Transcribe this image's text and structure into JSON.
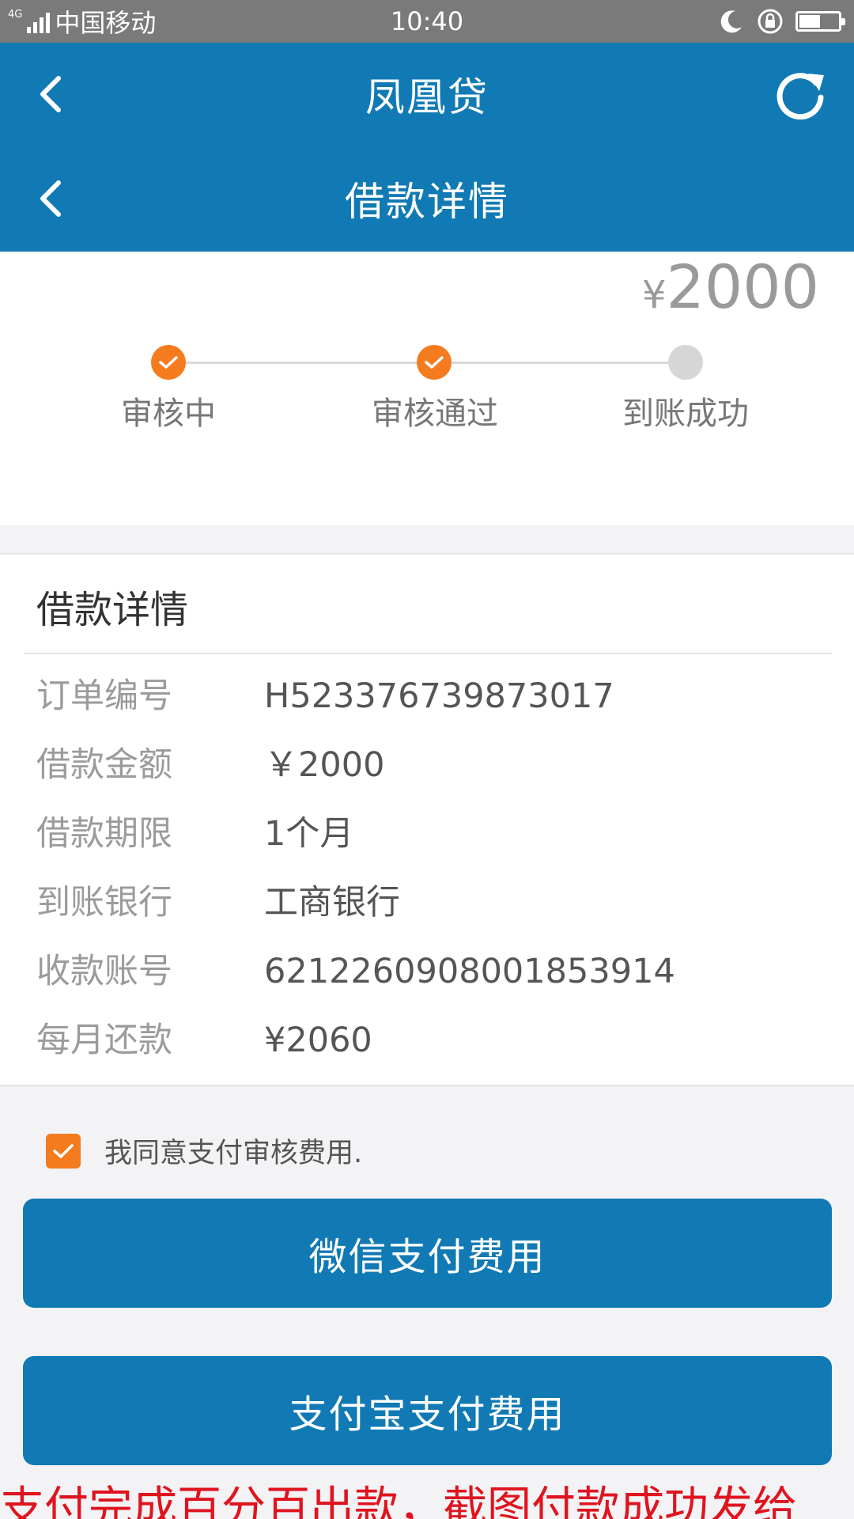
{
  "status_bar": {
    "network_small": "4G",
    "carrier": "中国移动",
    "time": "10:40"
  },
  "header": {
    "app_title": "凤凰贷",
    "page_title": "借款详情"
  },
  "progress": {
    "currency_symbol": "¥",
    "amount": "2000",
    "steps": [
      {
        "label": "审核中",
        "state": "done"
      },
      {
        "label": "审核通过",
        "state": "done"
      },
      {
        "label": "到账成功",
        "state": "pending"
      }
    ]
  },
  "details": {
    "title": "借款详情",
    "rows": [
      {
        "label": "订单编号",
        "value": "H523376739873017"
      },
      {
        "label": "借款金额",
        "value": "￥2000"
      },
      {
        "label": "借款期限",
        "value": "1个月"
      },
      {
        "label": "到账银行",
        "value": "工商银行"
      },
      {
        "label": "收款账号",
        "value": "6212260908001853914"
      },
      {
        "label": "每月还款",
        "value": "¥2060"
      }
    ]
  },
  "agreement": {
    "checked": true,
    "text": "我同意支付审核费用."
  },
  "buttons": {
    "wechat": "微信支付费用",
    "alipay": "支付宝支付费用"
  },
  "notice": "支付完成百分百出款，截图付款成功发给",
  "colors": {
    "primary": "#117ab5",
    "accent": "#f57b1f",
    "notice": "#e0141e"
  }
}
